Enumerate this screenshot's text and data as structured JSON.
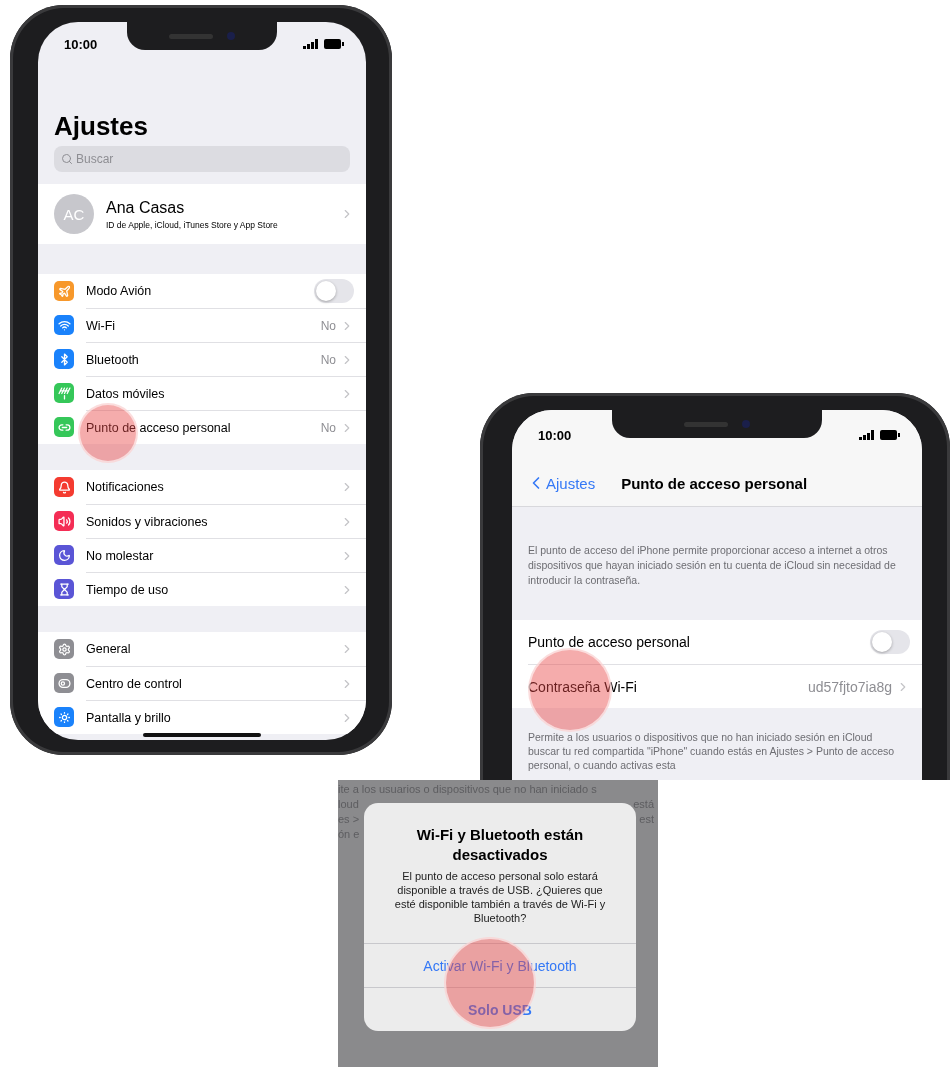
{
  "settings_screen": {
    "status_time": "10:00",
    "title": "Ajustes",
    "search": {
      "placeholder": "Buscar"
    },
    "profile": {
      "initials": "AC",
      "name": "Ana Casas",
      "subtitle": "ID de Apple, iCloud, iTunes Store y App Store"
    },
    "groups": [
      {
        "rows": [
          {
            "kind": "toggle",
            "label": "Modo Avión",
            "color": "#f7982b",
            "on": false
          },
          {
            "kind": "link",
            "label": "Wi-Fi",
            "value": "No",
            "color": "#1a82fb"
          },
          {
            "kind": "link",
            "label": "Bluetooth",
            "value": "No",
            "color": "#1a82fb"
          },
          {
            "kind": "link",
            "label": "Datos móviles",
            "color": "#35c759"
          },
          {
            "kind": "link",
            "label": "Punto de acceso personal",
            "value": "No",
            "color": "#35c759"
          }
        ]
      },
      {
        "rows": [
          {
            "kind": "link",
            "label": "Notificaciones",
            "color": "#f43b30"
          },
          {
            "kind": "link",
            "label": "Sonidos y vibraciones",
            "color": "#f42d55"
          },
          {
            "kind": "link",
            "label": "No molestar",
            "color": "#5a55d6"
          },
          {
            "kind": "link",
            "label": "Tiempo de uso",
            "color": "#5a55d6"
          }
        ]
      },
      {
        "rows": [
          {
            "kind": "link",
            "label": "General",
            "color": "#8e8e93"
          },
          {
            "kind": "link",
            "label": "Centro de control",
            "color": "#8e8e93"
          },
          {
            "kind": "link",
            "label": "Pantalla y brillo",
            "color": "#1a82fb"
          }
        ]
      }
    ]
  },
  "hotspot_screen": {
    "status_time": "10:00",
    "back_label": "Ajustes",
    "title": "Punto de acceso personal",
    "description": "El punto de acceso del iPhone permite proporcionar acceso a internet a otros dispositivos que hayan iniciado sesión en tu cuenta de iCloud sin necesidad de introducir la contraseña.",
    "rows": [
      {
        "kind": "toggle",
        "label": "Punto de acceso personal",
        "on": false
      },
      {
        "kind": "link",
        "label": "Contraseña Wi-Fi",
        "value": "ud57fjto7ia8g"
      }
    ],
    "footer": "Permite a los usuarios o dispositivos que no han iniciado sesión en iCloud buscar tu red compartida \"iPhone\" cuando estás en Ajustes > Punto de acceso personal, o cuando activas esta"
  },
  "alert_screen": {
    "background_lines": [
      {
        "left": "ite a los usuarios o dispositivos que no han iniciado s"
      },
      {
        "left": "loud",
        "right": "está"
      },
      {
        "left": "es >",
        "right": "est"
      },
      {
        "left": "ón e"
      }
    ],
    "alert": {
      "title": "Wi-Fi y Bluetooth están desactivados",
      "message": "El punto de acceso personal solo estará disponible a través de USB. ¿Quieres que esté disponible también a través de Wi-Fi y Bluetooth?",
      "buttons": [
        {
          "label": "Activar Wi-Fi y Bluetooth"
        },
        {
          "label": "Solo USB"
        }
      ]
    }
  }
}
